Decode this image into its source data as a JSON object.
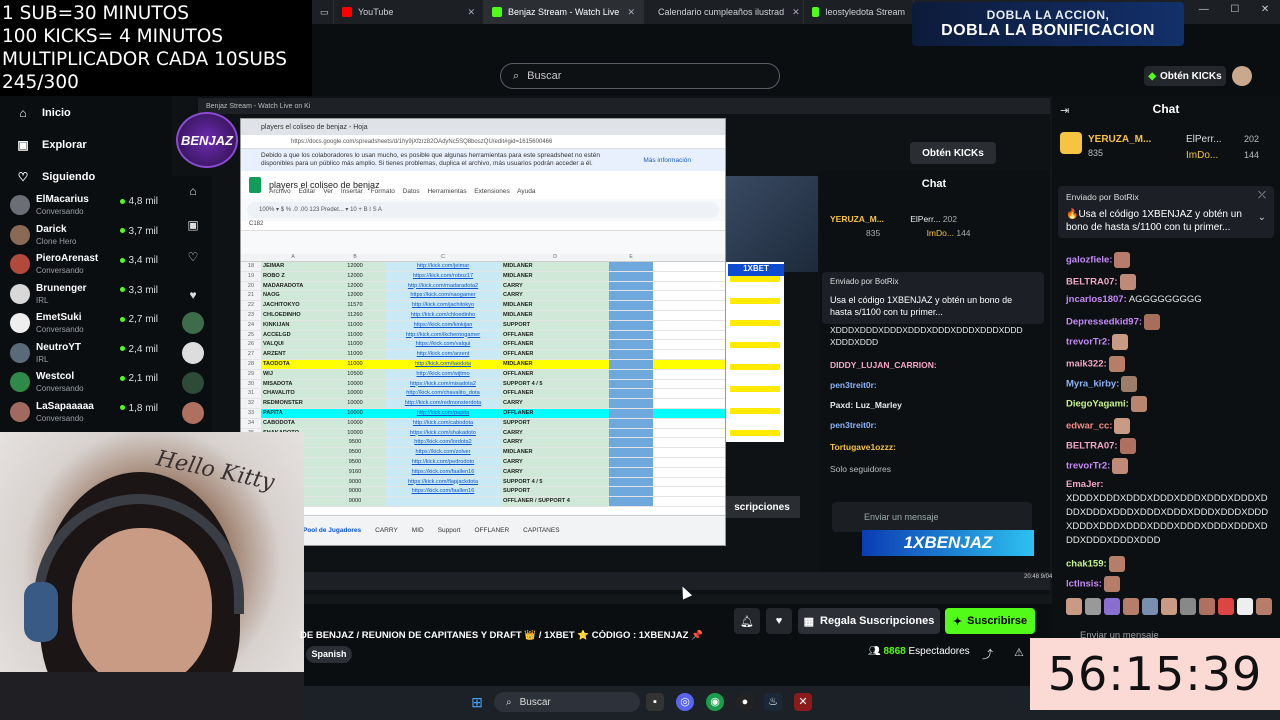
{
  "overlay": {
    "line1": "1 SUB=30 MINUTOS",
    "line2": "100 KICKS= 4 MINUTOS",
    "line3": "MULTIPLICADOR CADA 10SUBS",
    "line4": "245/300"
  },
  "browser_tabs": [
    {
      "label": "YouTube",
      "color": "#ff0000"
    },
    {
      "label": "Benjaz Stream - Watch Live",
      "color": "#53fc18",
      "active": true
    },
    {
      "label": "Calendario cumpleaños ilustrad",
      "color": "#1a73e8"
    },
    {
      "label": "leostyledota Stream",
      "color": "#53fc18"
    }
  ],
  "promo": {
    "line1": "DOBLA LA ACCION,",
    "line2": "DOBLA LA BONIFICACION"
  },
  "header": {
    "search_placeholder": "Buscar",
    "get_kicks": "Obtén KICKs"
  },
  "sidebar": {
    "nav": [
      {
        "label": "Inicio",
        "icon": "home-icon"
      },
      {
        "label": "Explorar",
        "icon": "browse-icon"
      },
      {
        "label": "Siguiendo",
        "icon": "heart-icon"
      }
    ],
    "channels": [
      {
        "name": "ElMacarius",
        "sub": "Conversando",
        "viewers": "4,8 mil",
        "color": "#6b6f75"
      },
      {
        "name": "Darick",
        "sub": "Clone Hero",
        "viewers": "3,7 mil",
        "color": "#8a6a55"
      },
      {
        "name": "PieroArenast",
        "sub": "Conversando",
        "viewers": "3,4 mil",
        "color": "#b04a3a"
      },
      {
        "name": "Brunenger",
        "sub": "IRL",
        "viewers": "3,3 mil",
        "color": "#d8d8d8"
      },
      {
        "name": "EmetSuki",
        "sub": "Conversando",
        "viewers": "2,7 mil",
        "color": "#eeeeee"
      },
      {
        "name": "NeutroYT",
        "sub": "IRL",
        "viewers": "2,4 mil",
        "color": "#5a6a7a"
      },
      {
        "name": "Westcol",
        "sub": "Conversando",
        "viewers": "2,1 mil",
        "color": "#2f8a4a"
      },
      {
        "name": "LaSapaaaaa",
        "sub": "Conversando",
        "viewers": "1,8 mil",
        "color": "#a06b5e"
      }
    ]
  },
  "inner": {
    "tab": "Benjaz Stream - Watch Live on Ki",
    "logo": "BENJAZ",
    "get_kicks": "Obtén KICKs",
    "chat_title": "Chat",
    "leader1": "YERUZA_M...",
    "leader1_pts": "835",
    "leader2": "ElPerr...",
    "leader2_pts": "202",
    "leader3": "ImDo...",
    "leader3_pts": "144",
    "pinned_head": "Enviado por  BotRix",
    "pinned_body": "Usa el código 1XBENJAZ y obtén un bono de hasta s/1100 con tu primer...",
    "messages": [
      "XDDDXDDDXDDDXDDDXDDDXDDDXDDDXDDD XDDDXDDD",
      "DIDDY_LUJAN_CARRION:",
      "pen3treit0r:",
      "Paxd: Luz_Marley",
      "pen3treit0r:",
      "Tortugave1ozzz:",
      "Solo seguidores"
    ],
    "input": "Enviar un mensaje",
    "banner": "1XBENJAZ",
    "subs_btn": "scripciones",
    "bet": "1XBET",
    "clock": "20:48 9/04/2026"
  },
  "sheet": {
    "tab": "players el coliseo de benjaz - Hoja",
    "url": "https://docs.google.com/spreadsheets/d/1hy9jXfzrz82OAdyNc5SQ8boszQU/edit#gid=1615600466",
    "notice": "Debido a que los colaboradores lo usan mucho, es posible que algunas herramientas para este spreadsheet no estén disponibles para un público más amplio. Si tienes problemas, duplica el archivo, más usuarios podrán acceder a él.",
    "more_info": "Más información",
    "title": "players el coliseo de benjaz",
    "menu": "Archivo Editar Ver Insertar Formato Datos Herramientas Extensiones Ayuda",
    "toolbar": "100%  ▾  $  %  .0  .00  123  Predet...  ▾  10  +  B  I  S  A",
    "cell_ref": "C182",
    "columns": [
      "A",
      "B",
      "C",
      "D",
      "E"
    ],
    "rows": [
      {
        "n": "18",
        "a": "JEIMAR",
        "b": "12000",
        "c": "http://kick.com/jeimar",
        "d": "MIDLANER"
      },
      {
        "n": "19",
        "a": "ROBO Z",
        "b": "12000",
        "c": "https://kick.com/roboz17",
        "d": "MIDLANER"
      },
      {
        "n": "20",
        "a": "MADARADOTA",
        "b": "12000",
        "c": "http://kick.com/madaradota2",
        "d": "CARRY"
      },
      {
        "n": "21",
        "a": "NAOG",
        "b": "12000",
        "c": "https://kick.com/naogamer",
        "d": "CARRY"
      },
      {
        "n": "22",
        "a": "JACHITOKYO",
        "b": "11570",
        "c": "http://kick.com/jachitokyo",
        "d": "MIDLANER"
      },
      {
        "n": "23",
        "a": "CHLOEDINHO",
        "b": "11260",
        "c": "http://kick.com/chloedinho",
        "d": "MIDLANER"
      },
      {
        "n": "24",
        "a": "KINKIJAN",
        "b": "11000",
        "c": "https://kick.com/kinkijan",
        "d": "SUPPORT"
      },
      {
        "n": "25",
        "a": "ACCELGD",
        "b": "11000",
        "c": "http://kick.com/ikchernogamer",
        "d": "OFFLANER"
      },
      {
        "n": "26",
        "a": "VALQUI",
        "b": "11000",
        "c": "https://kick.com/valqui",
        "d": "OFFLANER"
      },
      {
        "n": "27",
        "a": "ARZENT",
        "b": "11000",
        "c": "http://kick.com/arzent",
        "d": "OFFLANER"
      },
      {
        "n": "28",
        "a": "TAODOTA",
        "b": "11000",
        "c": "http://kick.com/taodota",
        "d": "MIDLANER",
        "hl": "yellow"
      },
      {
        "n": "29",
        "a": "WIJ",
        "b": "10500",
        "c": "http://kick.com/wijtmo",
        "d": "OFFLANER"
      },
      {
        "n": "30",
        "a": "MISADOTA",
        "b": "10000",
        "c": "https://kick.com/misadota2",
        "d": "SUPPORT 4 / 5"
      },
      {
        "n": "31",
        "a": "CHAVALITO",
        "b": "10000",
        "c": "http://kick.com/chavalito_dota",
        "d": "OFFLANER"
      },
      {
        "n": "32",
        "a": "REDMONSTER",
        "b": "10000",
        "c": "http://kick.com/redmonsterdota",
        "d": "CARRY"
      },
      {
        "n": "33",
        "a": "PAPITA",
        "b": "10000",
        "c": "http://kick.com/papita",
        "d": "OFFLANER",
        "hl": "cyan"
      },
      {
        "n": "34",
        "a": "CABODOTA",
        "b": "10000",
        "c": "http://kick.com/cabodota",
        "d": "SUPPORT"
      },
      {
        "n": "35",
        "a": "SHAKADOTO",
        "b": "10000",
        "c": "https://kick.com/shakadoto",
        "d": "CARRY"
      },
      {
        "n": "36",
        "a": "",
        "b": "9500",
        "c": "http://kick.com/lordota2",
        "d": "CARRY"
      },
      {
        "n": "37",
        "a": "",
        "b": "9500",
        "c": "https://kick.com/zolver",
        "d": "MIDLANER"
      },
      {
        "n": "38",
        "a": "",
        "b": "9500",
        "c": "http://kick.com/pedrodoto",
        "d": "CARRY"
      },
      {
        "n": "39",
        "a": "",
        "b": "9160",
        "c": "https://kick.com/faallen16",
        "d": "CARRY"
      },
      {
        "n": "40",
        "a": "",
        "b": "9000",
        "c": "https://kick.com/flapjackdota",
        "d": "SUPPORT 4 / 5"
      },
      {
        "n": "41",
        "a": "",
        "b": "9000",
        "c": "https://kick.com/faallen16",
        "d": "SUPPORT"
      },
      {
        "n": "42",
        "a": "",
        "b": "9000",
        "c": "",
        "d": "OFFLANER / SUPPORT 4"
      }
    ],
    "sheet_tabs": [
      "Pool de Jugadores",
      "CARRY",
      "MID",
      "Support",
      "OFFLANER",
      "CAPITANES"
    ]
  },
  "actions": {
    "gift": "Regala Suscripciones",
    "subscribe": "Suscribirse"
  },
  "stream_info": {
    "title": "DE BENJAZ / REUNION DE CAPITANES Y DRAFT 👑 / 1XBET ⭐ CÓDIGO : 1XBENJAZ 📌",
    "language": "Spanish",
    "viewers_count": "8868",
    "viewers_label": "Espectadores"
  },
  "taskbar": {
    "search": "Buscar"
  },
  "chat": {
    "title": "Chat",
    "leader1": "YERUZA_M...",
    "leader1_pts": "835",
    "leader2": "ElPerr...",
    "leader2_pts": "202",
    "leader3": "ImDo...",
    "leader3_pts": "144",
    "pinned_head": "Enviado por  BotRix",
    "pinned_body": "🔥Usa el código 1XBENJAZ y obtén un bono de hasta s/1100 con tu primer...",
    "messages": [
      {
        "user": "galozfiele:",
        "color": "#c58af9",
        "text": ""
      },
      {
        "user": "BELTRA07:",
        "color": "#f2a7c3",
        "text": ""
      },
      {
        "user": "jncarlos1807:",
        "color": "#c58af9",
        "text": " AGGGGGGGGG"
      },
      {
        "user": "Depressedkid97:",
        "color": "#c58af9",
        "text": ""
      },
      {
        "user": "trevorTr2:",
        "color": "#c58af9",
        "text": ""
      },
      {
        "user": "maik322:",
        "color": "#f2a7c3",
        "text": ""
      },
      {
        "user": "Myra_kirby:",
        "color": "#8ab4f8",
        "text": ""
      },
      {
        "user": "DiegoYagami:",
        "color": "#c6f68d",
        "text": ""
      },
      {
        "user": "edwar_cc:",
        "color": "#f28b82",
        "text": ""
      },
      {
        "user": "BELTRA07:",
        "color": "#f2a7c3",
        "text": ""
      },
      {
        "user": "trevorTr2:",
        "color": "#c58af9",
        "text": ""
      }
    ],
    "spam_user": "EmaJer:",
    "spam_text": "XDDDXDDDXDDDXDDDXDDDXDDDXDDDXDDDXDDDXDDDXDDDXDDDXDDDXDDDXDDDXDDDXDDDXDDDXDDDXDDDXDDDXDDDXDDDXDDDXDDDXDDD",
    "after": [
      {
        "user": "chak159:",
        "color": "#c6f68d"
      },
      {
        "user": "lctlnsis:",
        "color": "#c58af9"
      }
    ],
    "input_placeholder": "Enviar un mensaje"
  },
  "timer": "56:15:39",
  "colors": {
    "kick_green": "#53fc18",
    "bg": "#0b0e11",
    "timer_bg": "#fbd9d4"
  }
}
